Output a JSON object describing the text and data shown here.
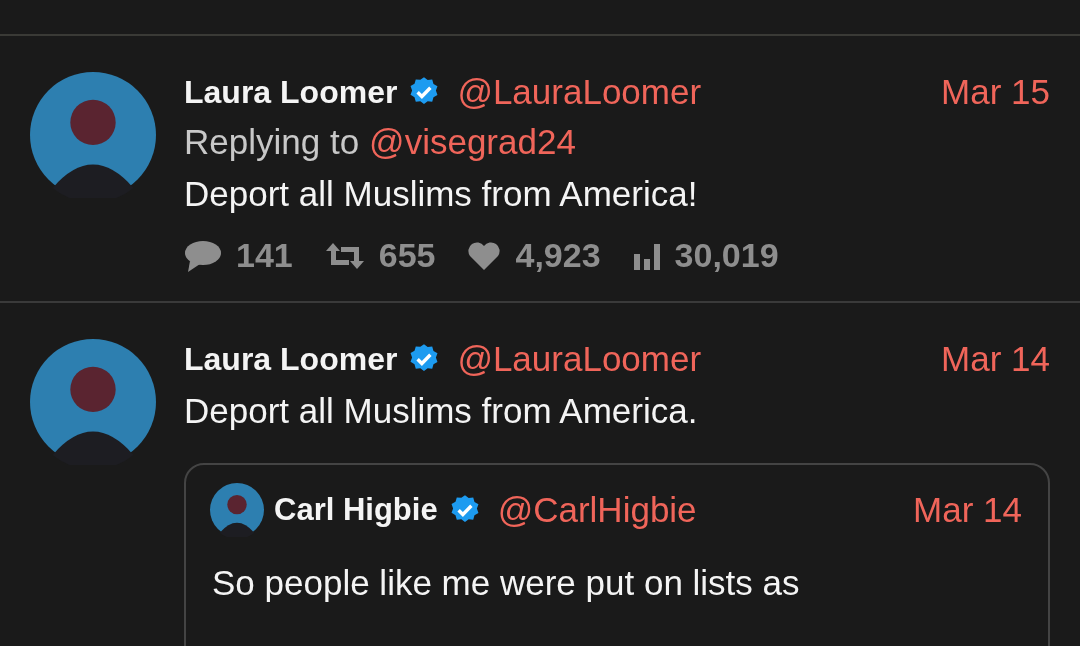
{
  "tweets": [
    {
      "name": "Laura Loomer",
      "verified": true,
      "handle": "@LauraLoomer",
      "date": "Mar 15",
      "replying_label": "Replying to",
      "replying_to": "@visegrad24",
      "text": "Deport all Muslims from America!",
      "stats": [
        {
          "kind": "replies",
          "value": "141"
        },
        {
          "kind": "retweets",
          "value": "655"
        },
        {
          "kind": "likes",
          "value": "4,923"
        },
        {
          "kind": "views",
          "value": "30,019"
        }
      ]
    },
    {
      "name": "Laura Loomer",
      "verified": true,
      "handle": "@LauraLoomer",
      "date": "Mar 14",
      "text": "Deport all Muslims from America.",
      "quote": {
        "name": "Carl Higbie",
        "verified": true,
        "handle": "@CarlHigbie",
        "date": "Mar 14",
        "text": "So people like me were put on lists as"
      }
    }
  ]
}
